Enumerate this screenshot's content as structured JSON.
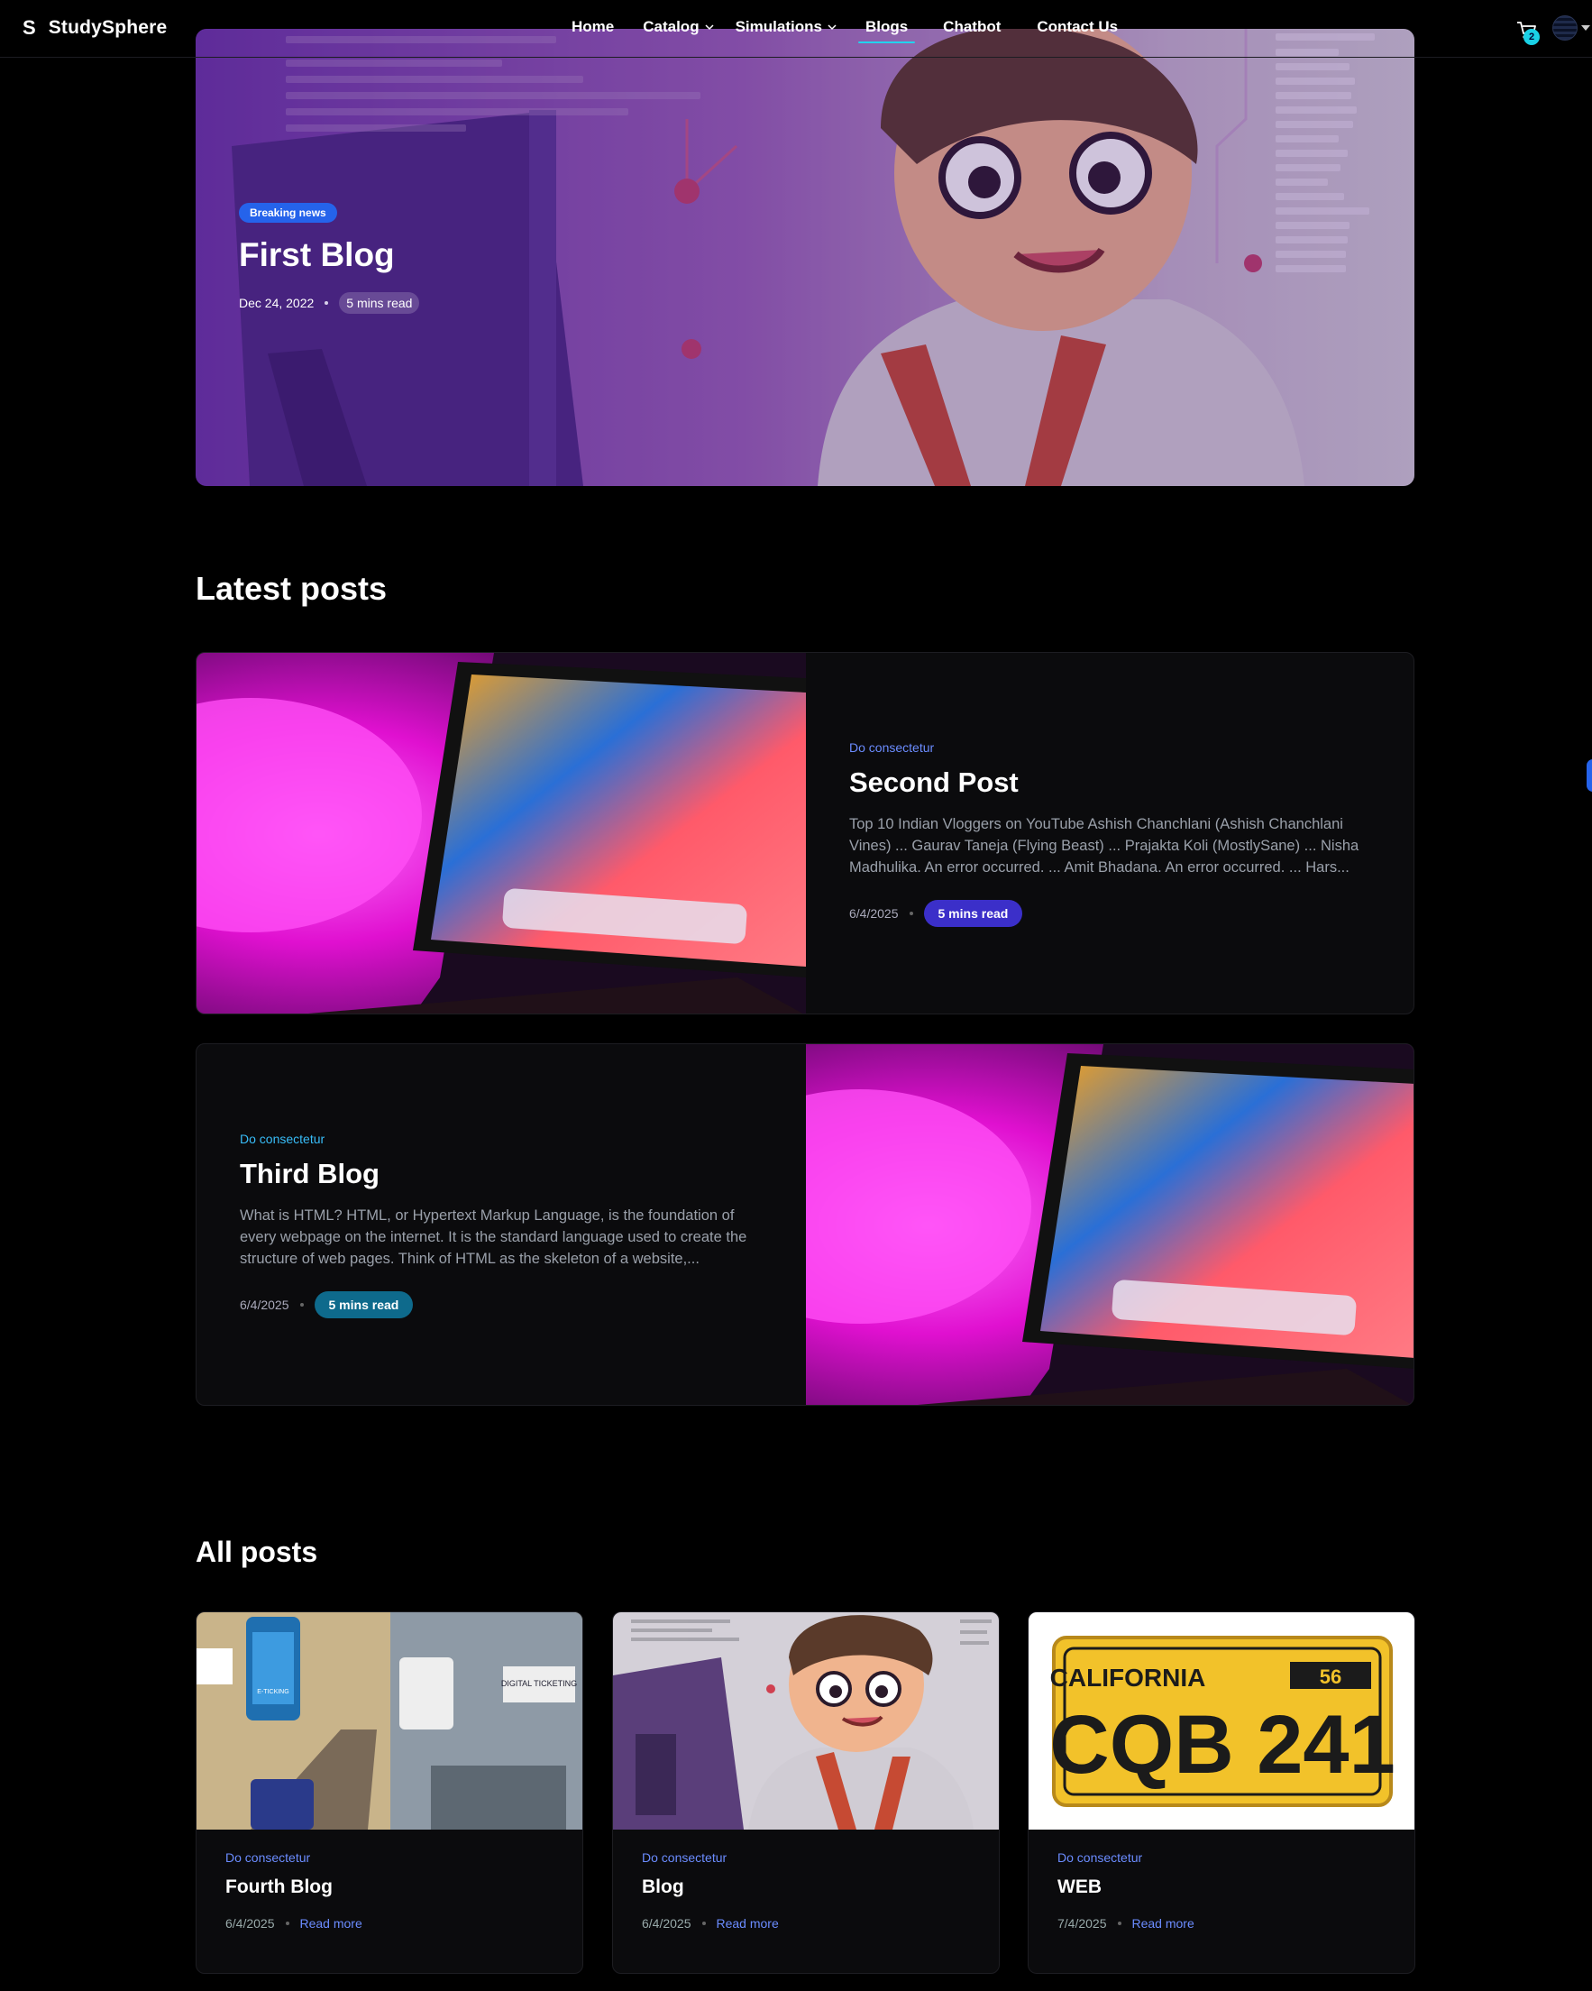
{
  "brand": {
    "logo_mark": "S",
    "name": "StudySphere"
  },
  "nav": {
    "items": [
      {
        "label": "Home",
        "dropdown": false
      },
      {
        "label": "Catalog",
        "dropdown": true
      },
      {
        "label": "Simulations",
        "dropdown": true
      },
      {
        "label": "Blogs",
        "dropdown": false,
        "active": true
      },
      {
        "label": "Chatbot",
        "dropdown": false
      },
      {
        "label": "Contact Us",
        "dropdown": false
      }
    ],
    "cart_count": "2"
  },
  "hero": {
    "badge": "Breaking news",
    "title": "First Blog",
    "date": "Dec 24, 2022",
    "read_time": "5 mins read"
  },
  "latest": {
    "title": "Latest posts",
    "posts": [
      {
        "category": "Do consectetur",
        "title": "Second Post",
        "excerpt": "Top 10 Indian Vloggers on YouTube Ashish Chanchlani (Ashish Chanchlani Vines) ... Gaurav Taneja (Flying Beast) ... Prajakta Koli (MostlySane) ... Nisha Madhulika. An error occurred. ... Amit Bhadana. An error occurred. ... Hars...",
        "date": "6/4/2025",
        "read_time": "5 mins read"
      },
      {
        "category": "Do consectetur",
        "title": "Third Blog",
        "excerpt": "What is HTML? HTML, or Hypertext Markup Language, is the foundation of every webpage on the internet. It is the standard language used to create the structure of web pages. Think of HTML as the skeleton of a website,...",
        "date": "6/4/2025",
        "read_time": "5 mins read"
      }
    ]
  },
  "all_posts": {
    "title": "All posts",
    "posts": [
      {
        "category": "Do consectetur",
        "title": "Fourth Blog",
        "date": "6/4/2025",
        "link": "Read more",
        "image": "e-ticketing-illustration"
      },
      {
        "category": "Do consectetur",
        "title": "Blog",
        "date": "6/4/2025",
        "link": "Read more",
        "image": "cartoon-coder-illustration"
      },
      {
        "category": "Do consectetur",
        "title": "WEB",
        "date": "7/4/2025",
        "link": "Read more",
        "image": "california-license-plate"
      }
    ]
  },
  "hero_image": "cartoon-coder-illustration",
  "latest_image": "tablet-on-desk-with-pink-lamp",
  "plate": {
    "state": "CALIFORNIA",
    "number": "CQB 241",
    "year": "56"
  },
  "ticket_art": {
    "left_label": "E-TICKING",
    "right_label": "DIGITAL TICKETING"
  },
  "colors": {
    "accent": "#22d3ee",
    "badge_blue": "#2563eb",
    "pill_indigo": "#3b2fc9",
    "pill_teal": "#0e6a8c",
    "link_blue": "#6b8cff"
  }
}
